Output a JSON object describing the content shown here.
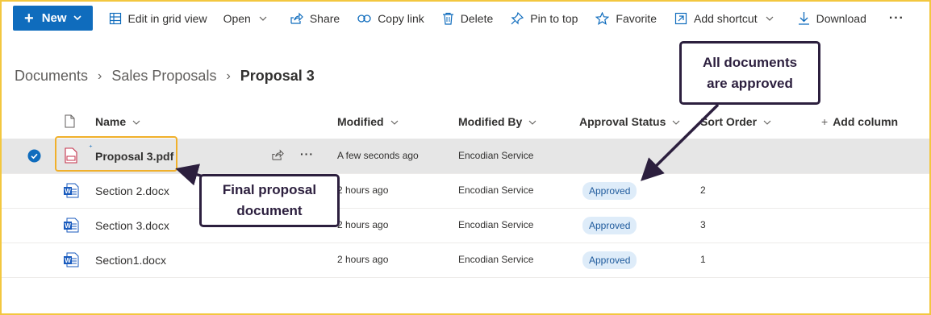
{
  "toolbar": {
    "new_label": "New",
    "edit_grid_label": "Edit in grid view",
    "open_label": "Open",
    "share_label": "Share",
    "copy_link_label": "Copy link",
    "delete_label": "Delete",
    "pin_label": "Pin to top",
    "favorite_label": "Favorite",
    "add_shortcut_label": "Add shortcut",
    "download_label": "Download",
    "more_label": "···"
  },
  "breadcrumb": {
    "items": [
      "Documents",
      "Sales Proposals"
    ],
    "current": "Proposal 3",
    "separator": "›"
  },
  "columns": {
    "name": "Name",
    "modified": "Modified",
    "modified_by": "Modified By",
    "approval_status": "Approval Status",
    "sort_order": "Sort Order",
    "add_column": "Add column"
  },
  "rows": [
    {
      "name": "Proposal 3.pdf",
      "modified": "A few seconds ago",
      "modified_by": "Encodian Service",
      "status": "",
      "sort_order": "",
      "selected": true,
      "type": "pdf"
    },
    {
      "name": "Section 2.docx",
      "modified": "2 hours ago",
      "modified_by": "Encodian Service",
      "status": "Approved",
      "sort_order": "2",
      "selected": false,
      "type": "docx"
    },
    {
      "name": "Section 3.docx",
      "modified": "2 hours ago",
      "modified_by": "Encodian Service",
      "status": "Approved",
      "sort_order": "3",
      "selected": false,
      "type": "docx"
    },
    {
      "name": "Section1.docx",
      "modified": "2 hours ago",
      "modified_by": "Encodian Service",
      "status": "Approved",
      "sort_order": "1",
      "selected": false,
      "type": "docx"
    }
  ],
  "annotations": {
    "approved_line1": "All documents",
    "approved_line2": "are approved",
    "final_line1": "Final proposal",
    "final_line2": "document"
  },
  "colors": {
    "accent": "#0f6cbd",
    "highlight_border": "#f3c73f",
    "callout_border": "#2c1f3e",
    "badge_bg": "#deecf9"
  }
}
